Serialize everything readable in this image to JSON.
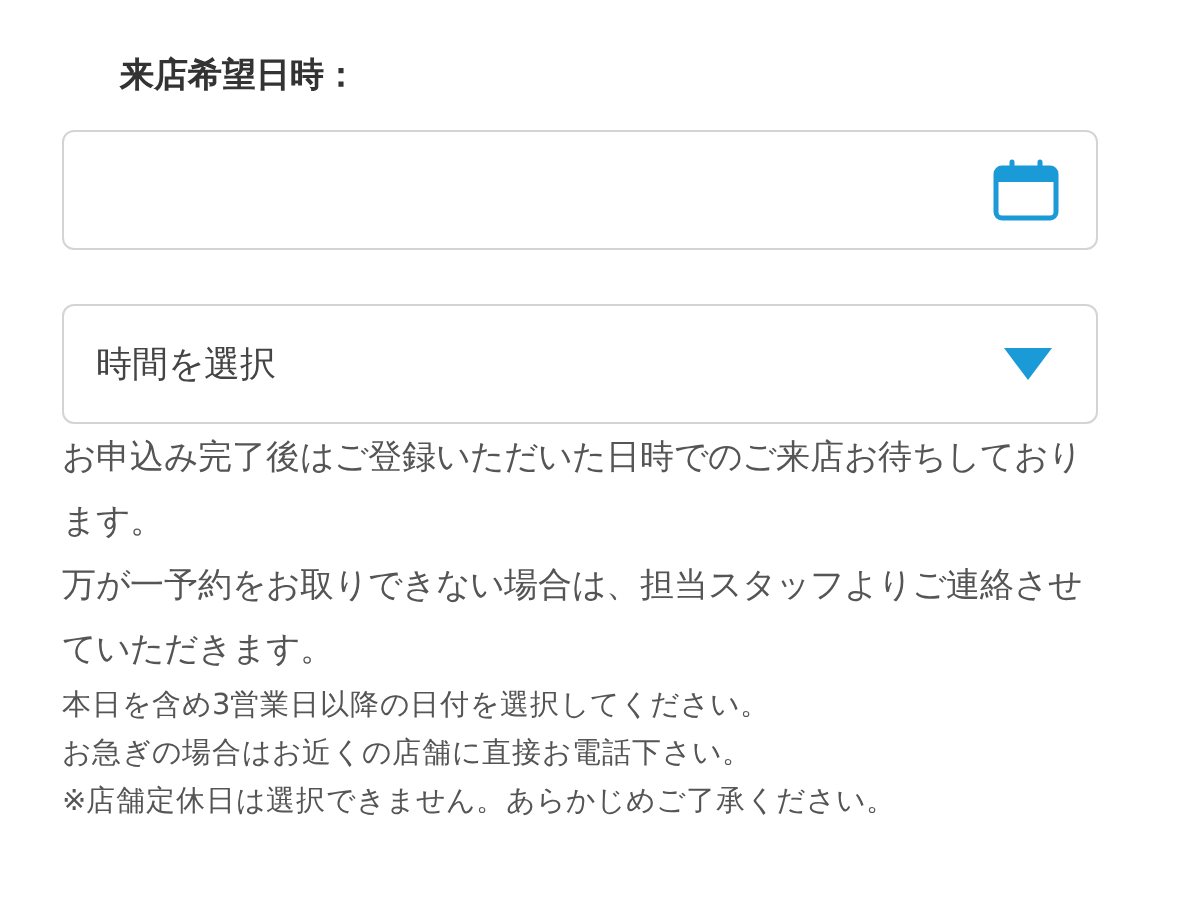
{
  "label": "来店希望日時：",
  "date_field": {
    "kind": "date"
  },
  "time_select": {
    "value": "時間を選択"
  },
  "notes_large": [
    "お申込み完了後はご登録いただいた日時でのご来店お待ちしております。",
    "万が一予約をお取りできない場合は、担当スタッフよりご連絡させていただきます。"
  ],
  "notes_small": [
    "本日を含め3営業日以降の日付を選択してください。",
    "お急ぎの場合はお近くの店舗に直接お電話下さい。",
    "※店舗定休日は選択できません。あらかじめご了承ください。"
  ]
}
